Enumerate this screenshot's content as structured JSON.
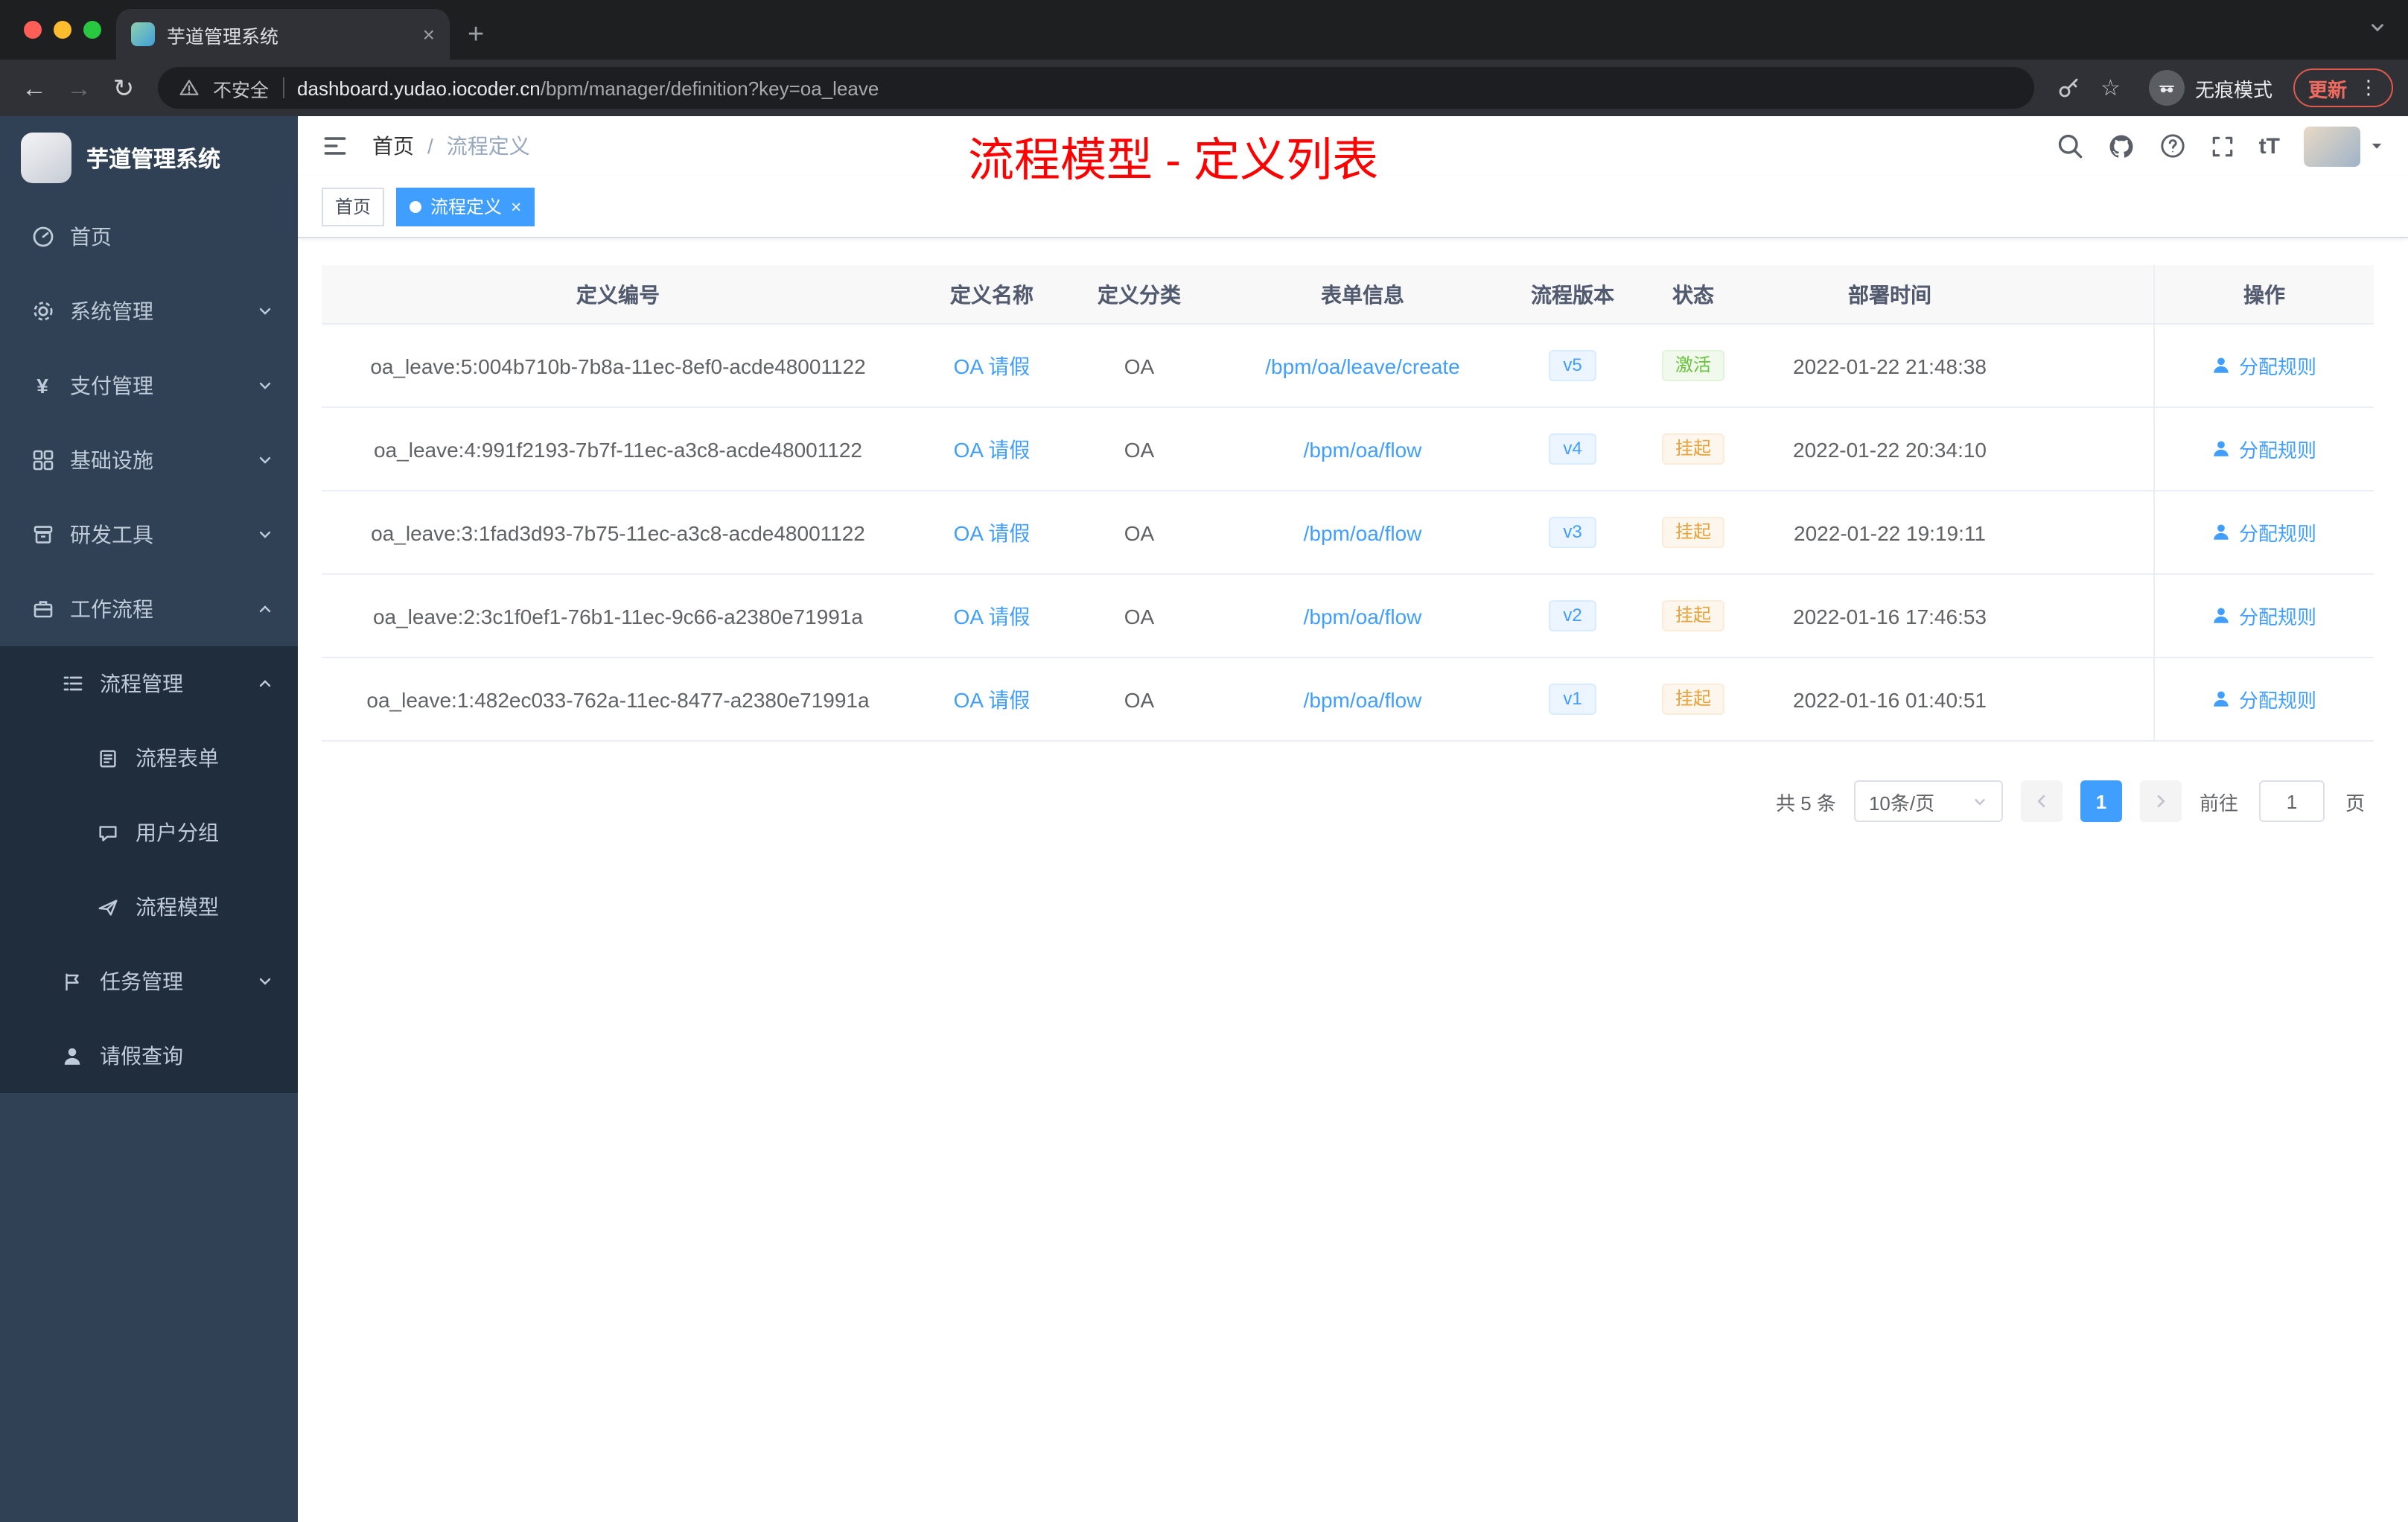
{
  "colors": {
    "accent": "#409eff",
    "success": "#67c23a",
    "warning": "#e6a23c",
    "annotation": "#ff0000",
    "sidebar": "#304156",
    "sidebar_sub": "#1f2d3d"
  },
  "browser": {
    "tab_title": "芋道管理系统",
    "new_tab_label": "+",
    "security_label": "不安全",
    "url_domain": "dashboard.yudao.iocoder.cn",
    "url_path": "/bpm/manager/definition?key=oa_leave",
    "incognito_label": "无痕模式",
    "update_label": "更新"
  },
  "sidebar": {
    "app_title": "芋道管理系统",
    "items": [
      {
        "label": "首页"
      },
      {
        "label": "系统管理"
      },
      {
        "label": "支付管理"
      },
      {
        "label": "基础设施"
      },
      {
        "label": "研发工具"
      },
      {
        "label": "工作流程"
      },
      {
        "label": "流程管理"
      },
      {
        "label": "流程表单"
      },
      {
        "label": "用户分组"
      },
      {
        "label": "流程模型"
      },
      {
        "label": "任务管理"
      },
      {
        "label": "请假查询"
      }
    ]
  },
  "header": {
    "breadcrumb_home": "首页",
    "breadcrumb_separator": "/",
    "breadcrumb_current": "流程定义",
    "annotation": "流程模型 - 定义列表",
    "textsize_label": "tT"
  },
  "tags": {
    "home": "首页",
    "current": "流程定义"
  },
  "table": {
    "columns": {
      "id": "定义编号",
      "name": "定义名称",
      "category": "定义分类",
      "form": "表单信息",
      "version": "流程版本",
      "status": "状态",
      "time": "部署时间",
      "action": "操作"
    },
    "rows": [
      {
        "id": "oa_leave:5:004b710b-7b8a-11ec-8ef0-acde48001122",
        "name": "OA 请假",
        "category": "OA",
        "form": "/bpm/oa/leave/create",
        "version": "v5",
        "status": "激活",
        "time": "2022-01-22 21:48:38",
        "action": "分配规则"
      },
      {
        "id": "oa_leave:4:991f2193-7b7f-11ec-a3c8-acde48001122",
        "name": "OA 请假",
        "category": "OA",
        "form": "/bpm/oa/flow",
        "version": "v4",
        "status": "挂起",
        "time": "2022-01-22 20:34:10",
        "action": "分配规则"
      },
      {
        "id": "oa_leave:3:1fad3d93-7b75-11ec-a3c8-acde48001122",
        "name": "OA 请假",
        "category": "OA",
        "form": "/bpm/oa/flow",
        "version": "v3",
        "status": "挂起",
        "time": "2022-01-22 19:19:11",
        "action": "分配规则"
      },
      {
        "id": "oa_leave:2:3c1f0ef1-76b1-11ec-9c66-a2380e71991a",
        "name": "OA 请假",
        "category": "OA",
        "form": "/bpm/oa/flow",
        "version": "v2",
        "status": "挂起",
        "time": "2022-01-16 17:46:53",
        "action": "分配规则"
      },
      {
        "id": "oa_leave:1:482ec033-762a-11ec-8477-a2380e71991a",
        "name": "OA 请假",
        "category": "OA",
        "form": "/bpm/oa/flow",
        "version": "v1",
        "status": "挂起",
        "time": "2022-01-16 01:40:51",
        "action": "分配规则"
      }
    ]
  },
  "pagination": {
    "total": "共 5 条",
    "page_size": "10条/页",
    "page": "1",
    "goto_label": "前往",
    "goto_value": "1",
    "page_unit": "页"
  }
}
